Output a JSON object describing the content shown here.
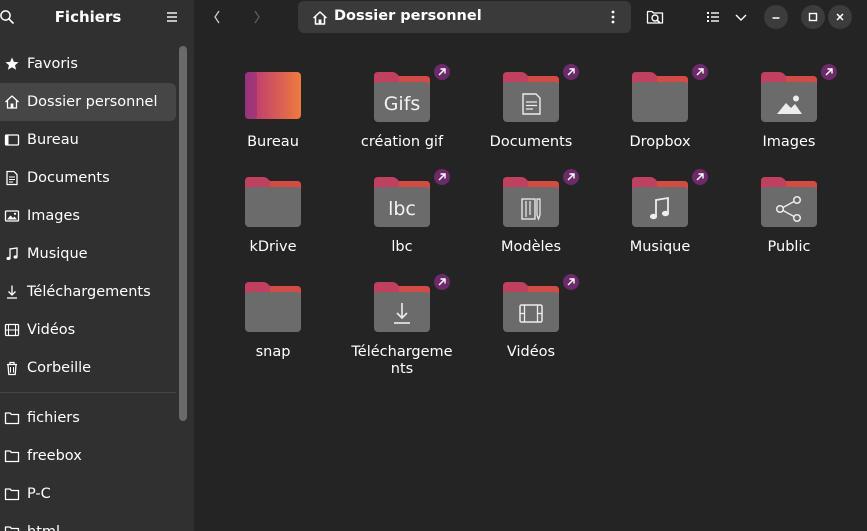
{
  "window": {
    "sidebar_title": "Fichiers",
    "location": "Dossier personnel"
  },
  "sidebar": {
    "places": [
      {
        "label": "Favoris",
        "icon": "star-icon"
      },
      {
        "label": "Dossier personnel",
        "icon": "home-icon",
        "active": true
      },
      {
        "label": "Bureau",
        "icon": "desktop-icon"
      },
      {
        "label": "Documents",
        "icon": "document-icon"
      },
      {
        "label": "Images",
        "icon": "image-icon"
      },
      {
        "label": "Musique",
        "icon": "music-icon"
      },
      {
        "label": "Téléchargements",
        "icon": "download-icon"
      },
      {
        "label": "Vidéos",
        "icon": "video-icon"
      },
      {
        "label": "Corbeille",
        "icon": "trash-icon"
      }
    ],
    "bookmarks": [
      {
        "label": "fichiers",
        "icon": "folder-icon"
      },
      {
        "label": "freebox",
        "icon": "folder-icon"
      },
      {
        "label": "P-C",
        "icon": "folder-icon"
      },
      {
        "label": "html",
        "icon": "folder-icon"
      }
    ]
  },
  "files": [
    {
      "label": "Bureau",
      "type": "desktop",
      "link": false
    },
    {
      "label": "création gif",
      "type": "text",
      "glyph": "Gifs",
      "link": true
    },
    {
      "label": "Documents",
      "type": "documents",
      "link": true
    },
    {
      "label": "Dropbox",
      "type": "plain",
      "link": true
    },
    {
      "label": "Images",
      "type": "pictures",
      "link": true
    },
    {
      "label": "kDrive",
      "type": "plain",
      "link": false
    },
    {
      "label": "lbc",
      "type": "text",
      "glyph": "lbc",
      "link": true
    },
    {
      "label": "Modèles",
      "type": "templates",
      "link": true
    },
    {
      "label": "Musique",
      "type": "music",
      "link": true
    },
    {
      "label": "Public",
      "type": "share",
      "link": false
    },
    {
      "label": "snap",
      "type": "plain",
      "link": false
    },
    {
      "label": "Téléchargements",
      "label_lines": [
        "Téléchargeme",
        "nts"
      ],
      "type": "download",
      "link": true
    },
    {
      "label": "Vidéos",
      "type": "videos",
      "link": true
    }
  ],
  "colors": {
    "background": "#242424",
    "sidebar": "#303030",
    "folder_back": "#c0405f",
    "folder_tab_accent": "#e0552f",
    "folder_front": "#6b6b6b",
    "link_badge": "#6c2a6b"
  }
}
